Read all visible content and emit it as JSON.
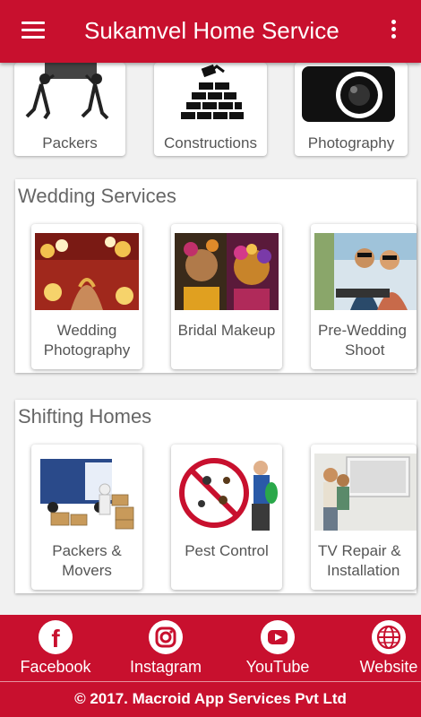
{
  "app_bar": {
    "title": "Sukamvel Home Service"
  },
  "top_categories": [
    {
      "label": "Packers"
    },
    {
      "label": "Constructions"
    },
    {
      "label": "Photography"
    }
  ],
  "sections": [
    {
      "title": "Wedding Services",
      "items": [
        {
          "label_line1": "Wedding",
          "label_line2": "Photography"
        },
        {
          "label_line1": "Bridal Makeup",
          "label_line2": ""
        },
        {
          "label_line1": "Pre-Wedding",
          "label_line2": "Shoot"
        }
      ]
    },
    {
      "title": "Shifting Homes",
      "items": [
        {
          "label_line1": "Packers &",
          "label_line2": "Movers"
        },
        {
          "label_line1": "Pest Control",
          "label_line2": ""
        },
        {
          "label_line1": "TV Repair &",
          "label_line2": "Installation"
        }
      ]
    }
  ],
  "footer": {
    "social": [
      {
        "label": "Facebook",
        "icon": "facebook-icon"
      },
      {
        "label": "Instagram",
        "icon": "instagram-icon"
      },
      {
        "label": "YouTube",
        "icon": "youtube-icon"
      },
      {
        "label": "Website",
        "icon": "globe-icon"
      }
    ],
    "copyright": "© 2017. Macroid App Services Pvt Ltd"
  },
  "colors": {
    "primary": "#c8102e",
    "card_bg": "#ffffff",
    "page_bg": "#f1f1f1",
    "label_text": "#555555"
  }
}
